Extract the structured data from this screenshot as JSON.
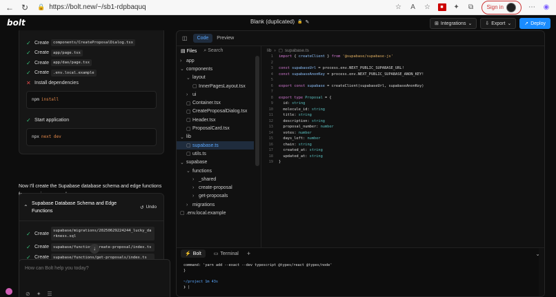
{
  "browser": {
    "url": "https://bolt.new/~/sb1-rdpbaquq",
    "signin": "Sign in"
  },
  "app": {
    "logo": "bolt",
    "project": "Blank (duplicated)",
    "integrations": "Integrations",
    "export": "Export",
    "deploy": "Deploy"
  },
  "chat": {
    "steps_top": [
      {
        "status": "done",
        "label": "Create",
        "code": "components/CreateProposalDialog.tsx"
      },
      {
        "status": "done",
        "label": "Create",
        "code": "app/page.tsx"
      },
      {
        "status": "done",
        "label": "Create",
        "code": "app/dao/page.tsx"
      },
      {
        "status": "done",
        "label": "Create",
        "code": ".env.local.example"
      },
      {
        "status": "fail",
        "label": "Install dependencies"
      }
    ],
    "install_cmd": {
      "cmd": "npm",
      "arg": "install"
    },
    "start_label": "Start application",
    "start_cmd": {
      "cmd": "npx",
      "arg": "next dev"
    },
    "message": "Now I'll create the Supabase database schema and edge functions for managing proposals:",
    "card2_title": "Supabase Database Schema and Edge Functions",
    "undo": "Undo",
    "steps2": [
      {
        "label": "Create",
        "code": "supabase/migrations/20250629224244_lucky_darkness.sql"
      },
      {
        "label": "Create",
        "code": "supabase/functions/create-proposal/index.ts"
      },
      {
        "label": "Create",
        "code": "supabase/functions/get-proposals/index.ts"
      }
    ],
    "input_placeholder": "How can Bolt help you today?"
  },
  "editor": {
    "tabs": [
      "Code",
      "Preview"
    ],
    "files_label": "Files",
    "search_label": "Search",
    "breadcrumb": [
      "lib",
      "supabase.ts"
    ],
    "tree": [
      {
        "name": "app",
        "type": "folder",
        "depth": 0,
        "open": false
      },
      {
        "name": "components",
        "type": "folder",
        "depth": 0,
        "open": true
      },
      {
        "name": "layout",
        "type": "folder",
        "depth": 1,
        "open": true
      },
      {
        "name": "InnerPagesLayout.tsx",
        "type": "file",
        "depth": 2
      },
      {
        "name": "ui",
        "type": "folder",
        "depth": 1,
        "open": false
      },
      {
        "name": "Container.tsx",
        "type": "file",
        "depth": 1
      },
      {
        "name": "CreateProposalDialog.tsx",
        "type": "file",
        "depth": 1
      },
      {
        "name": "Header.tsx",
        "type": "file",
        "depth": 1
      },
      {
        "name": "ProposalCard.tsx",
        "type": "file",
        "depth": 1
      },
      {
        "name": "lib",
        "type": "folder",
        "depth": 0,
        "open": true
      },
      {
        "name": "supabase.ts",
        "type": "file",
        "depth": 1,
        "selected": true
      },
      {
        "name": "utils.ts",
        "type": "file",
        "depth": 1
      },
      {
        "name": "supabase",
        "type": "folder",
        "depth": 0,
        "open": true
      },
      {
        "name": "functions",
        "type": "folder",
        "depth": 1,
        "open": true
      },
      {
        "name": "_shared",
        "type": "folder",
        "depth": 2,
        "open": false
      },
      {
        "name": "create-proposal",
        "type": "folder",
        "depth": 2,
        "open": false
      },
      {
        "name": "get-proposals",
        "type": "folder",
        "depth": 2,
        "open": false
      },
      {
        "name": "migrations",
        "type": "folder",
        "depth": 1,
        "open": false
      },
      {
        "name": ".env.local.example",
        "type": "file",
        "depth": 0
      }
    ],
    "code": [
      [
        [
          "kw",
          "import "
        ],
        [
          "pl",
          "{ "
        ],
        [
          "id",
          "createClient"
        ],
        [
          "pl",
          " } "
        ],
        [
          "kw",
          "from "
        ],
        [
          "str",
          "'@supabase/supabase-js'"
        ]
      ],
      [],
      [
        [
          "kw",
          "const "
        ],
        [
          "id",
          "supabaseUrl"
        ],
        [
          "pl",
          " = process.env.NEXT_PUBLIC_SUPABASE_URL!"
        ]
      ],
      [
        [
          "kw",
          "const "
        ],
        [
          "id",
          "supabaseAnonKey"
        ],
        [
          "pl",
          " = process.env.NEXT_PUBLIC_SUPABASE_ANON_KEY!"
        ]
      ],
      [],
      [
        [
          "kw",
          "export const "
        ],
        [
          "id",
          "supabase"
        ],
        [
          "pl",
          " = createClient(supabaseUrl, supabaseAnonKey)"
        ]
      ],
      [],
      [
        [
          "kw",
          "export type "
        ],
        [
          "ty",
          "Proposal"
        ],
        [
          "pl",
          " = {"
        ]
      ],
      [
        [
          "pl",
          "  id: "
        ],
        [
          "ty",
          "string"
        ]
      ],
      [
        [
          "pl",
          "  molecule_id: "
        ],
        [
          "ty",
          "string"
        ]
      ],
      [
        [
          "pl",
          "  title: "
        ],
        [
          "ty",
          "string"
        ]
      ],
      [
        [
          "pl",
          "  description: "
        ],
        [
          "ty",
          "string"
        ]
      ],
      [
        [
          "pl",
          "  proposal_number: "
        ],
        [
          "ty",
          "number"
        ]
      ],
      [
        [
          "pl",
          "  votes: "
        ],
        [
          "ty",
          "number"
        ]
      ],
      [
        [
          "pl",
          "  days_left: "
        ],
        [
          "ty",
          "number"
        ]
      ],
      [
        [
          "pl",
          "  chain: "
        ],
        [
          "ty",
          "string"
        ]
      ],
      [
        [
          "pl",
          "  created_at: "
        ],
        [
          "ty",
          "string"
        ]
      ],
      [
        [
          "pl",
          "  updated_at: "
        ],
        [
          "ty",
          "string"
        ]
      ],
      [
        [
          "pl",
          "}"
        ]
      ]
    ],
    "terminal_tabs": [
      "Bolt",
      "Terminal"
    ],
    "terminal_lines": [
      {
        "text": "command: 'yarn add --exact --dev typescript @types/react @types/node'"
      },
      {
        "text": "}"
      },
      {
        "text": ""
      },
      {
        "text": "~/project 1m 43s",
        "color": "#5ba8ff"
      },
      {
        "text": "❯ |"
      }
    ]
  }
}
